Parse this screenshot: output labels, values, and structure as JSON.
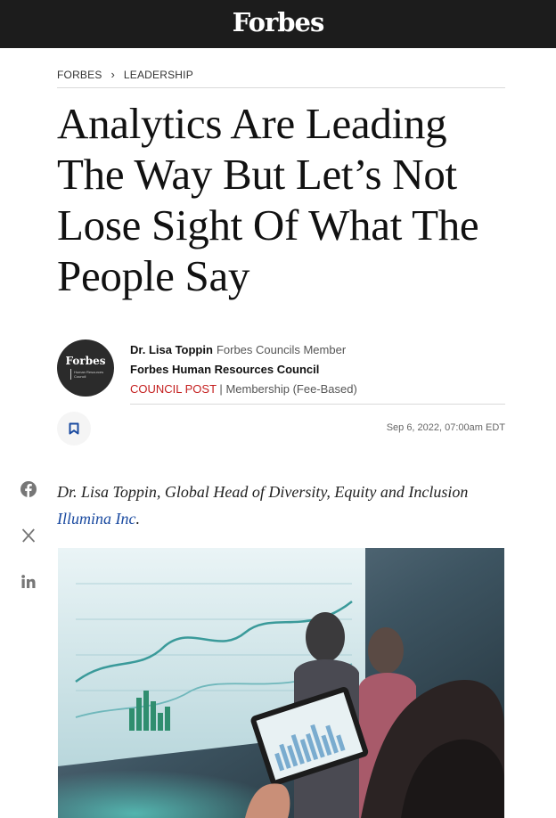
{
  "header": {
    "logo": "Forbes"
  },
  "breadcrumb": {
    "items": [
      "FORBES",
      "LEADERSHIP"
    ]
  },
  "article": {
    "headline": "Analytics Are Leading The Way But Let’s Not Lose Sight Of What The People Say",
    "date": "Sep 6, 2022, 07:00am EDT",
    "author_note_text": "Dr. Lisa Toppin, Global Head of Diversity, Equity and Inclusion ",
    "author_note_company": "Illumina Inc",
    "author_note_period": "."
  },
  "author": {
    "name": "Dr. Lisa Toppin",
    "role": "Forbes Councils Member",
    "council": "Forbes Human Resources Council",
    "post_label": "COUNCIL POST",
    "separator": "|",
    "membership": "Membership (Fee-Based)",
    "avatar_logo": "Forbes",
    "avatar_sub": "Human Resources Council"
  },
  "social": {
    "icons": [
      "facebook-icon",
      "x-icon",
      "linkedin-icon"
    ]
  },
  "colors": {
    "topbar": "#1c1c1c",
    "council_post": "#c41e1e",
    "company_link": "#1a4aa0"
  }
}
